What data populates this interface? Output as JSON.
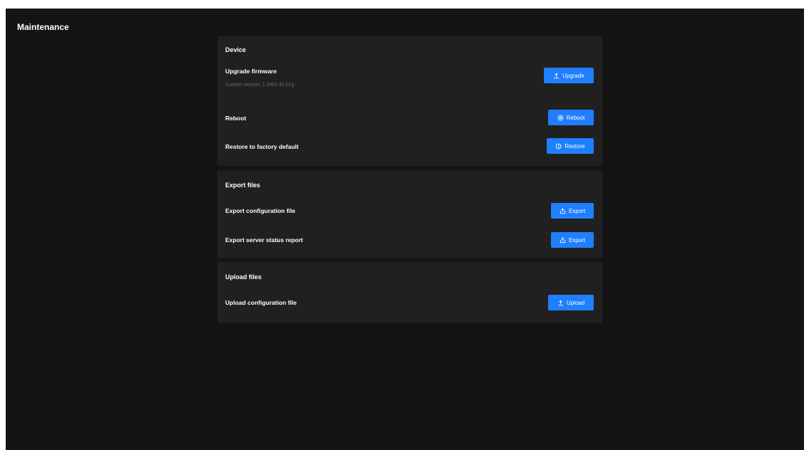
{
  "page": {
    "title": "Maintenance"
  },
  "device": {
    "title": "Device",
    "upgrade_label": "Upgrade firmware",
    "current_version": "Current version: 1.2402.42.01g",
    "upgrade_button": "Upgrade",
    "reboot_label": "Reboot",
    "reboot_button": "Reboot",
    "restore_label": "Restore to factory default",
    "restore_button": "Restore"
  },
  "export": {
    "title": "Export files",
    "config_label": "Export configuration file",
    "config_button": "Export",
    "status_label": "Export server status report",
    "status_button": "Export"
  },
  "upload": {
    "title": "Upload files",
    "config_label": "Upload configuration file",
    "config_button": "Upload"
  },
  "icons": {
    "upgrade": "upload-icon",
    "reboot": "reboot-icon",
    "restore": "restore-icon",
    "export": "export-icon",
    "upload": "upload-icon"
  },
  "colors": {
    "background": "#141414",
    "card": "#202020",
    "accent": "#1f7fff"
  }
}
